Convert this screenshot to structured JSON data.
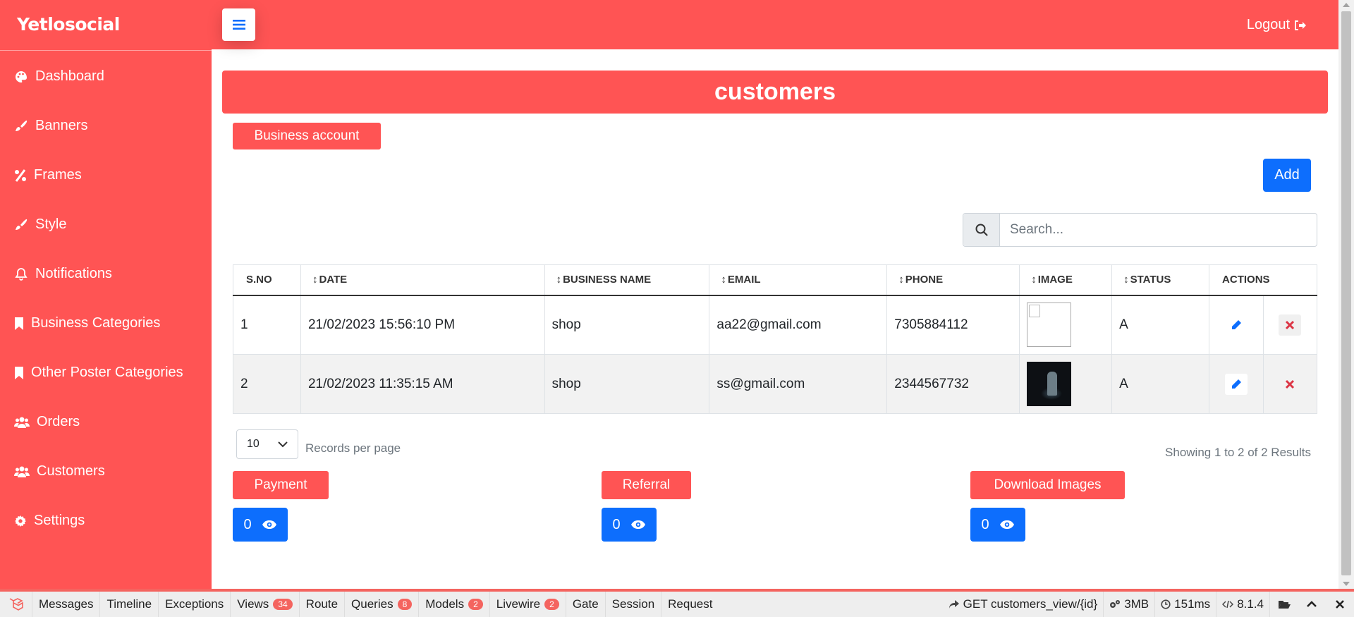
{
  "brand": "Yetlosocial",
  "header": {
    "logout_label": "Logout"
  },
  "sidebar": {
    "items": [
      {
        "label": "Dashboard",
        "icon": "palette-icon"
      },
      {
        "label": "Banners",
        "icon": "paint-brush-icon"
      },
      {
        "label": "Frames",
        "icon": "percent-icon"
      },
      {
        "label": "Style",
        "icon": "paint-brush-icon"
      },
      {
        "label": "Notifications",
        "icon": "bell-icon"
      },
      {
        "label": "Business Categories",
        "icon": "bookmark-icon"
      },
      {
        "label": "Other Poster Categories",
        "icon": "bookmark-icon"
      },
      {
        "label": "Orders",
        "icon": "users-icon"
      },
      {
        "label": "Customers",
        "icon": "users-icon"
      },
      {
        "label": "Settings",
        "icon": "gear-icon"
      }
    ]
  },
  "page": {
    "title": "customers",
    "business_account_label": "Business account",
    "add_label": "Add",
    "search_placeholder": "Search..."
  },
  "table": {
    "headers": [
      "S.NO",
      "DATE",
      "BUSINESS NAME",
      "EMAIL",
      "PHONE",
      "IMAGE",
      "STATUS",
      "ACTIONS"
    ],
    "sort_glyph": "↕",
    "rows": [
      {
        "sno": "1",
        "date": "21/02/2023 15:56:10 PM",
        "business_name": "shop",
        "email": "aa22@gmail.com",
        "phone": "7305884112",
        "image": "broken-image",
        "status": "A"
      },
      {
        "sno": "2",
        "date": "21/02/2023 11:35:15 AM",
        "business_name": "shop",
        "email": "ss@gmail.com",
        "phone": "2344567732",
        "image": "dark-photo-thumbnail",
        "status": "A"
      }
    ]
  },
  "pagination": {
    "per_page": "10",
    "per_page_label": "Records per page",
    "showing": "Showing 1 to 2 of 2 Results"
  },
  "summary": [
    {
      "label": "Payment",
      "count": "0"
    },
    {
      "label": "Referral",
      "count": "0"
    },
    {
      "label": "Download Images",
      "count": "0"
    }
  ],
  "debugbar": {
    "tabs": [
      {
        "label": "Messages"
      },
      {
        "label": "Timeline"
      },
      {
        "label": "Exceptions"
      },
      {
        "label": "Views",
        "badge": "34"
      },
      {
        "label": "Route"
      },
      {
        "label": "Queries",
        "badge": "8"
      },
      {
        "label": "Models",
        "badge": "2"
      },
      {
        "label": "Livewire",
        "badge": "2"
      },
      {
        "label": "Gate"
      },
      {
        "label": "Session"
      },
      {
        "label": "Request"
      }
    ],
    "route": "GET customers_view/{id}",
    "memory": "3MB",
    "time": "151ms",
    "php_version": "8.1.4"
  },
  "colors": {
    "accent": "#ff5454",
    "primary": "#0d6efd",
    "danger": "#dc3545"
  }
}
